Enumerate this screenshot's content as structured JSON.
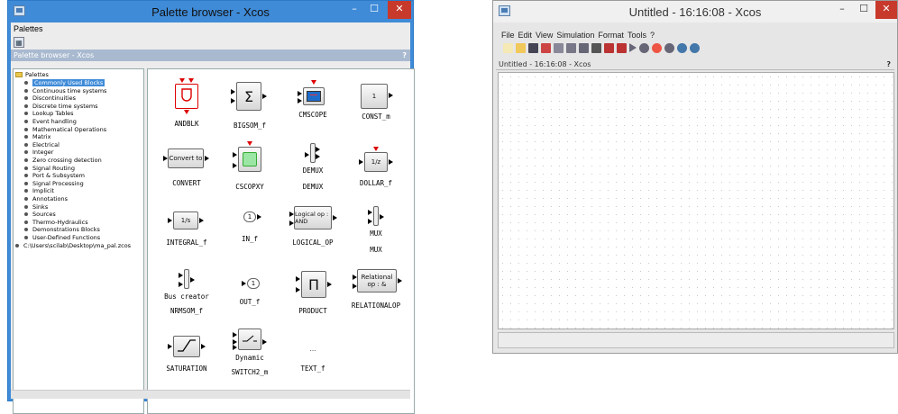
{
  "palette_window": {
    "title": "Palette browser - Xcos",
    "menu": [
      "Palettes"
    ],
    "panel_title": "Palette browser - Xcos",
    "panel_help": "?",
    "tree_root": "Palettes",
    "tree_items": [
      "Commonly Used Blocks",
      "Continuous time systems",
      "Discontinuities",
      "Discrete time systems",
      "Lookup Tables",
      "Event handling",
      "Mathematical Operations",
      "Matrix",
      "Electrical",
      "Integer",
      "Zero crossing detection",
      "Signal Routing",
      "Port & Subsystem",
      "Signal Processing",
      "Implicit",
      "Annotations",
      "Sinks",
      "Sources",
      "Thermo-Hydraulics",
      "Demonstrations Blocks",
      "User-Defined Functions"
    ],
    "tree_extra": "C:\\Users\\scilab\\Desktop\\ma_pal.zcos",
    "selected_item": "Commonly Used Blocks",
    "blocks": [
      {
        "name": "ANDBLK",
        "glyph": ""
      },
      {
        "name": "BIGSOM_f",
        "glyph": "Σ"
      },
      {
        "name": "CMSCOPE",
        "glyph": ""
      },
      {
        "name": "CONST_m",
        "glyph": "1"
      },
      {
        "name": "CONVERT",
        "glyph": "Convert to"
      },
      {
        "name": "CSCOPXY",
        "glyph": ""
      },
      {
        "name": "DEMUX",
        "glyph": "DEMUX"
      },
      {
        "name": "DOLLAR_f",
        "glyph": "1/z"
      },
      {
        "name": "INTEGRAL_f",
        "glyph": "1/s"
      },
      {
        "name": "IN_f",
        "glyph": "1"
      },
      {
        "name": "LOGICAL_OP",
        "glyph": "Logical op : AND"
      },
      {
        "name": "MUX",
        "glyph": "MUX"
      },
      {
        "name": "NRMSOM_f",
        "glyph": "Bus creator"
      },
      {
        "name": "OUT_f",
        "glyph": "1"
      },
      {
        "name": "PRODUCT",
        "glyph": "Π"
      },
      {
        "name": "RELATIONALOP",
        "glyph": "Relational op : &"
      },
      {
        "name": "SATURATION",
        "glyph": ""
      },
      {
        "name": "SWITCH2_m",
        "glyph": "Dynamic"
      },
      {
        "name": "TEXT_f",
        "glyph": "..."
      }
    ]
  },
  "xcos_window": {
    "title": "Untitled - 16:16:08 - Xcos",
    "menu": [
      "File",
      "Edit",
      "View",
      "Simulation",
      "Format",
      "Tools",
      "?"
    ],
    "panel_title": "Untitled - 16:16:08 - Xcos",
    "panel_help": "?",
    "toolbar_icons": [
      "new-icon",
      "open-icon",
      "open-folder-icon",
      "save-icon",
      "save-as-icon",
      "print-icon",
      "export-icon",
      "undo-icon",
      "redo-icon",
      "fit-icon",
      "start-icon",
      "stop-icon",
      "zoom-in-icon",
      "zoom-out-icon",
      "settings-icon",
      "help-icon"
    ]
  },
  "colors": {
    "accent": "#3f8bd8",
    "close": "#c7392b",
    "port": "#d00000"
  }
}
